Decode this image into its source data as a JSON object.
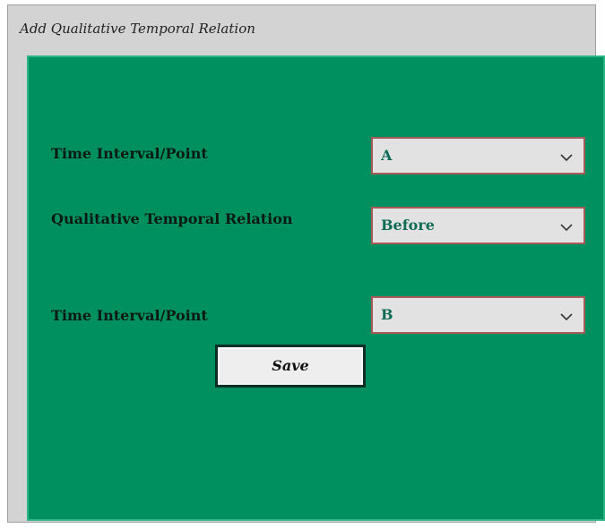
{
  "dialog": {
    "title": "Add Qualitative Temporal Relation"
  },
  "form": {
    "field1": {
      "label": "Time Interval/Point",
      "value": "A"
    },
    "field2": {
      "label": "Qualitative Temporal Relation",
      "value": "Before"
    },
    "field3": {
      "label": "Time Interval/Point",
      "value": "B"
    },
    "save_label": "Save"
  },
  "colors": {
    "panel_background": "#009060",
    "dialog_background": "#d3d3d3",
    "select_border": "#a85a5a",
    "select_text": "#0d6b55"
  },
  "icons": {
    "dropdown": "chevron-down-icon"
  }
}
